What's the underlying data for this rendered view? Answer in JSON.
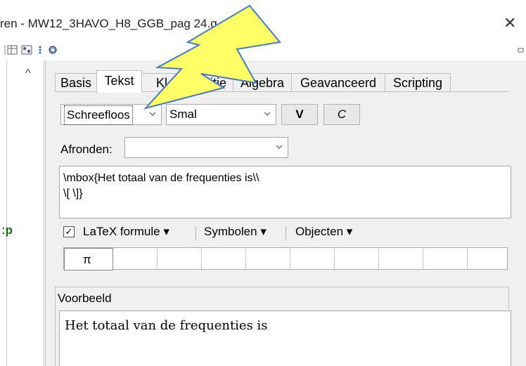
{
  "window": {
    "title": "ren - MW12_3HAVO_H8_GGB_pag 24.g",
    "close_glyph": "✕"
  },
  "toolbar": {
    "icons": [
      "table-icon",
      "graph-icon",
      "more-icon",
      "settings-icon"
    ]
  },
  "sidebar": {
    "scroll_glyph": "^",
    "partial_label": "ːp"
  },
  "tabs": [
    {
      "label": "Basis",
      "active": false
    },
    {
      "label": "Tekst",
      "active": true
    },
    {
      "label": "Kl",
      "active": false
    },
    {
      "label": "Positie",
      "active": false
    },
    {
      "label": "Algebra",
      "active": false
    },
    {
      "label": "Geavanceerd",
      "active": false
    },
    {
      "label": "Scripting",
      "active": false
    }
  ],
  "font_row": {
    "font_family": "Schreefloos",
    "font_size": "Smal",
    "bold_label": "V",
    "italic_label": "C"
  },
  "rounding": {
    "label": "Afronden:",
    "value": ""
  },
  "editor": {
    "line1": "\\mbox{Het totaal van de frequenties is\\\\",
    "line2": "\\[ \\]}"
  },
  "options": {
    "latex_checked": true,
    "check_glyph": "✓",
    "latex_label": "LaTeX formule ▾",
    "symbols_label": "Symbolen ▾",
    "objects_label": "Objecten ▾"
  },
  "symbols_grid": {
    "first_symbol": "π"
  },
  "preview": {
    "label": "Voorbeeld",
    "text": "Het totaal van de frequenties is"
  },
  "annotation": {
    "type": "lightning-bolt-arrow",
    "fill_color": "#ffff66",
    "stroke_color": "#4a7ac0"
  }
}
